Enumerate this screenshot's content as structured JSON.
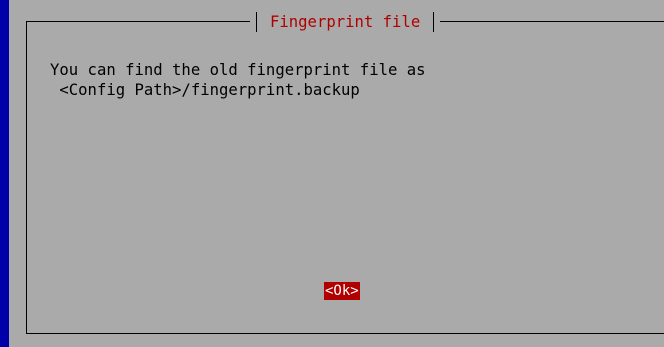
{
  "dialog": {
    "title": "Fingerprint file",
    "message_line1": "You can find the old fingerprint file as",
    "message_line2": " <Config Path>/fingerprint.backup",
    "ok_button_label": "<Ok>"
  },
  "colors": {
    "background": "#0000a8",
    "dialog": "#aaaaaa",
    "title_text": "#b00000",
    "button_background": "#b00000",
    "button_text": "#ffffff"
  }
}
